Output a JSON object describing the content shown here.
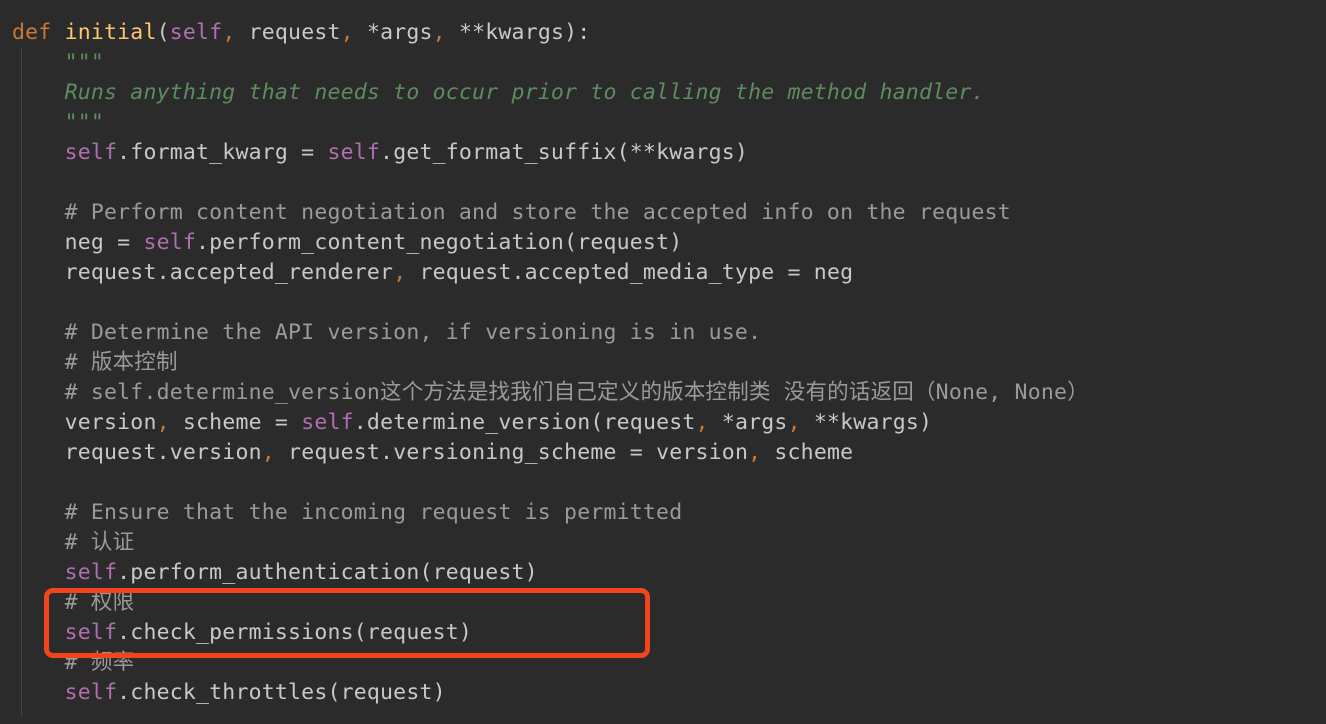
{
  "editor": {
    "background_color": "#2b2b2b",
    "language": "python",
    "colors": {
      "keyword": "#cc7832",
      "function_name": "#ffc66d",
      "self_keyword": "#b06fb0",
      "comment": "#9a9a9a",
      "docstring": "#5f8c5f",
      "default_text": "#c8c8c8",
      "annotation_red": "#f4441e"
    }
  },
  "annotation": {
    "type": "rectangle-highlight",
    "color": "#f4441e",
    "covers_lines": [
      "# 权限",
      "self.check_permissions(request)"
    ]
  },
  "code": {
    "lines": [
      {
        "id": 1,
        "text": "def initial(self, request, *args, **kwargs):"
      },
      {
        "id": 2,
        "text": "    \"\"\""
      },
      {
        "id": 3,
        "text": "    Runs anything that needs to occur prior to calling the method handler."
      },
      {
        "id": 4,
        "text": "    \"\"\""
      },
      {
        "id": 5,
        "text": "    self.format_kwarg = self.get_format_suffix(**kwargs)"
      },
      {
        "id": 6,
        "text": ""
      },
      {
        "id": 7,
        "text": "    # Perform content negotiation and store the accepted info on the request"
      },
      {
        "id": 8,
        "text": "    neg = self.perform_content_negotiation(request)"
      },
      {
        "id": 9,
        "text": "    request.accepted_renderer, request.accepted_media_type = neg"
      },
      {
        "id": 10,
        "text": ""
      },
      {
        "id": 11,
        "text": "    # Determine the API version, if versioning is in use."
      },
      {
        "id": 12,
        "text": "    # 版本控制"
      },
      {
        "id": 13,
        "text": "    # self.determine_version这个方法是找我们自己定义的版本控制类 没有的话返回（None, None）"
      },
      {
        "id": 14,
        "text": "    version, scheme = self.determine_version(request, *args, **kwargs)"
      },
      {
        "id": 15,
        "text": "    request.version, request.versioning_scheme = version, scheme"
      },
      {
        "id": 16,
        "text": ""
      },
      {
        "id": 17,
        "text": "    # Ensure that the incoming request is permitted"
      },
      {
        "id": 18,
        "text": "    # 认证"
      },
      {
        "id": 19,
        "text": "    self.perform_authentication(request)"
      },
      {
        "id": 20,
        "text": "    # 权限"
      },
      {
        "id": 21,
        "text": "    self.check_permissions(request)"
      },
      {
        "id": 22,
        "text": "    # 频率"
      },
      {
        "id": 23,
        "text": "    self.check_throttles(request)"
      }
    ],
    "tokens": {
      "l1_def": "def ",
      "l1_name": "initial",
      "l1_open": "(",
      "l1_self": "self",
      "l1_c1": ", ",
      "l1_request": "request",
      "l1_c2": ", ",
      "l1_args": "*args",
      "l1_c3": ", ",
      "l1_kwargs": "**kwargs",
      "l1_close": "):",
      "l2": "\"\"\"",
      "l3": "Runs anything that needs to occur prior to calling the method handler.",
      "l4": "\"\"\"",
      "l5_self": "self",
      "l5_attr": ".format_kwarg = ",
      "l5_self2": "self",
      "l5_rest": ".get_format_suffix(**kwargs)",
      "l7": "# Perform content negotiation and store the accepted info on the request",
      "l8_pre": "neg = ",
      "l8_self": "self",
      "l8_rest": ".perform_content_negotiation(request)",
      "l9_a": "request.accepted_renderer",
      "l9_comma": ",",
      "l9_b": " request.accepted_media_type = neg",
      "l11": "# Determine the API version, if versioning is in use.",
      "l12": "# 版本控制",
      "l13": "# self.determine_version这个方法是找我们自己定义的版本控制类 没有的话返回（None, None）",
      "l14_a": "version",
      "l14_comma": ",",
      "l14_b": " scheme = ",
      "l14_self": "self",
      "l14_c": ".determine_version(request",
      "l14_comma2": ",",
      "l14_d": " *args",
      "l14_comma3": ",",
      "l14_e": " **kwargs)",
      "l15_a": "request.version",
      "l15_comma": ",",
      "l15_b": " request.versioning_scheme = version",
      "l15_comma2": ",",
      "l15_c": " scheme",
      "l17": "# Ensure that the incoming request is permitted",
      "l18": "# 认证",
      "l19_self": "self",
      "l19_rest": ".perform_authentication(request)",
      "l20": "# 权限",
      "l21_self": "self",
      "l21_rest": ".check_permissions(request)",
      "l22": "# 频率",
      "l23_self": "self",
      "l23_rest": ".check_throttles(request)"
    }
  }
}
